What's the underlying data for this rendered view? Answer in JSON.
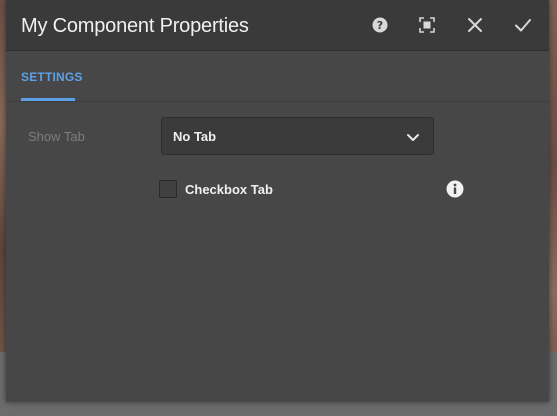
{
  "dialog": {
    "title": "My Component Properties",
    "toolbar": {
      "help_icon": "help-circle-icon",
      "fullscreen_icon": "fullscreen-icon",
      "close_icon": "close-icon",
      "done_icon": "checkmark-icon"
    }
  },
  "tabs": [
    {
      "label": "SETTINGS",
      "active": true
    }
  ],
  "form": {
    "show_tab_label": "Show Tab",
    "show_tab_value": "No Tab",
    "checkbox_label": "Checkbox Tab",
    "checkbox_checked": false,
    "info_icon": "info-icon"
  },
  "colors": {
    "dialog_bg": "#474747",
    "titlebar_bg": "#3a3a3a",
    "accent": "#5ea0e6",
    "text": "#f0f0f0",
    "muted_text": "#7d7d7d"
  }
}
